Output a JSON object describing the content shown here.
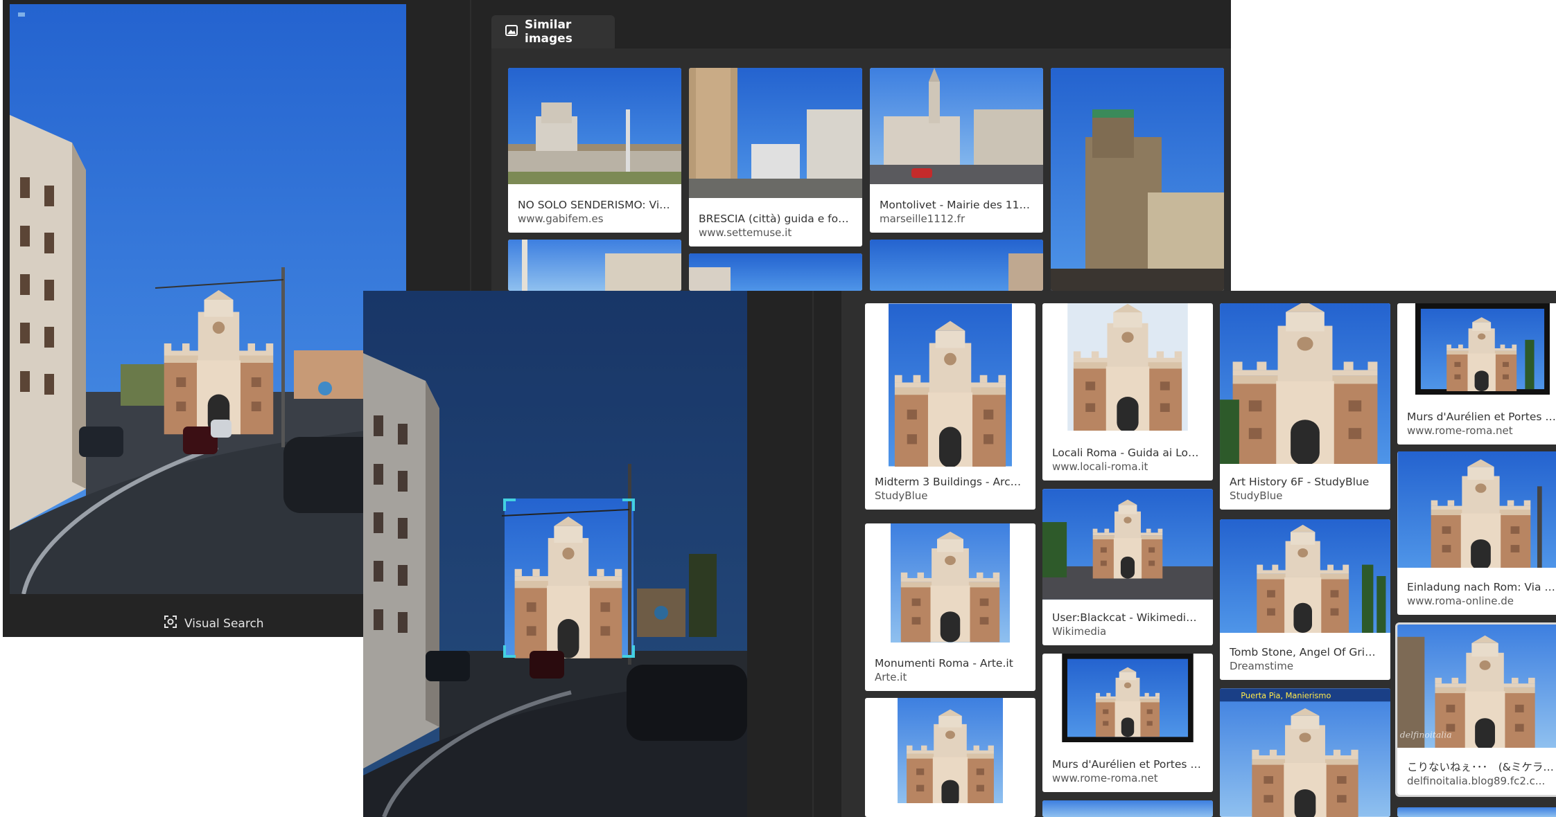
{
  "back_window": {
    "visual_search_label": "Visual Search",
    "tabs": [
      {
        "label": "Similar images",
        "icon": "image-icon",
        "active": true
      }
    ],
    "similar_images": [
      {
        "title": "NO SOLO SENDERISMO: Viaj...",
        "source": "www.gabifem.es"
      },
      {
        "title": "BRESCIA (città) guida e foto ...",
        "source": "www.settemuse.it"
      },
      {
        "title": "Montolivet - Mairie des 11e ...",
        "source": "marseille1112.fr"
      },
      {
        "title": "",
        "source": ""
      }
    ]
  },
  "front_window": {
    "results": [
      {
        "title": "Midterm 3 Buildings - Archit...",
        "source": "StudyBlue"
      },
      {
        "title": "Monumenti Roma - Arte.it",
        "source": "Arte.it"
      },
      {
        "title": "Locali Roma - Guida ai Local...",
        "source": "www.locali-roma.it"
      },
      {
        "title": "User:Blackcat - Wikimedia C...",
        "source": "Wikimedia"
      },
      {
        "title": "Murs d'Aurélien et Portes de ...",
        "source": "www.rome-roma.net"
      },
      {
        "title": "Art History 6F - StudyBlue",
        "source": "StudyBlue"
      },
      {
        "title": "Tomb Stone, Angel Of Grief, ...",
        "source": "Dreamstime"
      },
      {
        "title": "Murs d'Aurélien et Portes de ...",
        "source": "www.rome-roma.net"
      },
      {
        "title": "Einladung nach Rom: Via No...",
        "source": "www.roma-online.de"
      },
      {
        "title": "こりないねぇ･･･　(&ミケランジェロ...",
        "source": "delfinoitalia.blog89.fc2.c..."
      }
    ],
    "thumb_overlay_text": "Puerta Pia, Manierismo",
    "watermark_text": "delfinoitalia"
  },
  "colors": {
    "window_bg": "#242424",
    "panel_bg": "#2f2f2f",
    "sky": "#2f6fd6",
    "gate_stone": "#c9a888",
    "brick": "#b07a55",
    "crop_handle": "#43d0e0"
  }
}
